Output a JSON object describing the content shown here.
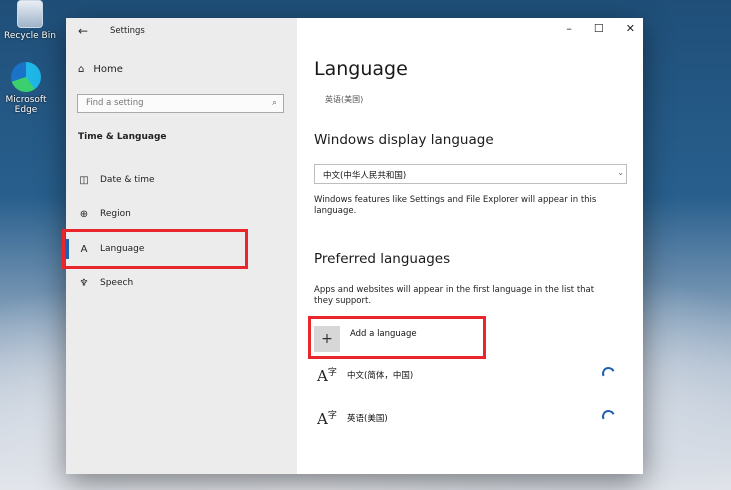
{
  "desktop": {
    "recycle_bin_label": "Recycle Bin",
    "edge_label": "Microsoft Edge"
  },
  "window": {
    "title": "Settings",
    "back_icon": "←",
    "controls": {
      "minimize": "–",
      "maximize": "☐",
      "close": "✕"
    }
  },
  "sidebar": {
    "home_label": "Home",
    "search_placeholder": "Find a setting",
    "section_title": "Time & Language",
    "items": [
      {
        "label": "Date & time",
        "icon": "calendar-clock-icon"
      },
      {
        "label": "Region",
        "icon": "globe-icon"
      },
      {
        "label": "Language",
        "icon": "language-icon",
        "active": true
      },
      {
        "label": "Speech",
        "icon": "microphone-icon"
      }
    ]
  },
  "main": {
    "title": "Language",
    "subtitle": "英语(美国)",
    "display_language": {
      "heading": "Windows display language",
      "selected": "中文(中华人民共和国)",
      "description": "Windows features like Settings and File Explorer will appear in this language."
    },
    "preferred": {
      "heading": "Preferred languages",
      "description": "Apps and websites will appear in the first language in the list that they support.",
      "add_label": "Add a language",
      "languages": [
        {
          "name": "中文(简体，中国)"
        },
        {
          "name": "英语(美国)"
        }
      ]
    }
  },
  "colors": {
    "highlight": "#e8262c",
    "accent": "#1f5fb0",
    "sidebar_bg": "#ececec"
  }
}
